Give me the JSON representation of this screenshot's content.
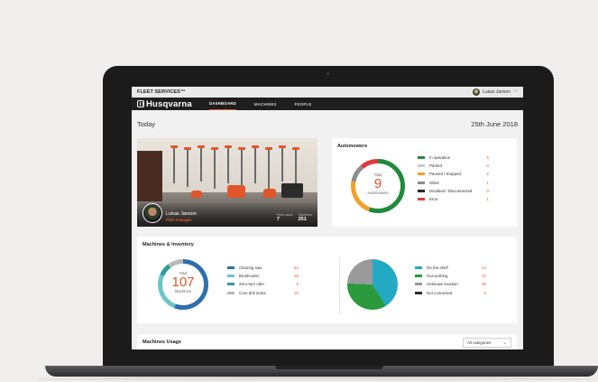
{
  "topbar": {
    "brand": "FLEET SERVICES™",
    "user_name": "Lukas Janson"
  },
  "nav": {
    "logo_text": "Husqvarna",
    "tabs": [
      {
        "label": "DASHBOARD",
        "active": true
      },
      {
        "label": "MACHINES",
        "active": false
      },
      {
        "label": "PEOPLE",
        "active": false
      }
    ]
  },
  "headline": {
    "today": "Today",
    "date": "25th June 2018"
  },
  "profile": {
    "name": "Lukas Janson",
    "role": "Fleet manager",
    "stats": [
      {
        "label": "Fleet users",
        "value": "7"
      },
      {
        "label": "Machines",
        "value": "251"
      }
    ]
  },
  "automowers": {
    "title": "Automowers",
    "center": {
      "label": "Total",
      "value": "9",
      "sub": "Automowers"
    },
    "items": [
      {
        "label": "In operation",
        "value": 5,
        "color": "#1f8a3b"
      },
      {
        "label": "Parked",
        "value": 0,
        "color": "#c9c9c9"
      },
      {
        "label": "Paused / Stopped",
        "value": 2,
        "color": "#f2a12a"
      },
      {
        "label": "Other",
        "value": 1,
        "color": "#8c8c8c"
      },
      {
        "label": "Disabled / Disconnected",
        "value": 0,
        "color": "#2b2b2b"
      },
      {
        "label": "Error",
        "value": 1,
        "color": "#e23b3b"
      }
    ]
  },
  "inventory": {
    "title": "Machines & Inventory",
    "center": {
      "label": "Total",
      "value": "107",
      "sub": "Machines"
    },
    "types": [
      {
        "label": "Clearing saw",
        "value": 54,
        "color": "#2f6fb0"
      },
      {
        "label": "Brushcutter",
        "value": 25,
        "color": "#6cc4c9"
      },
      {
        "label": "Zero-turn rider",
        "value": 8,
        "color": "#2c9c9a"
      },
      {
        "label": "Core drill motor",
        "value": 10,
        "color": "#b8b8b8"
      }
    ],
    "status": [
      {
        "label": "On the shelf",
        "value": 44,
        "color": "#22a9c4"
      },
      {
        "label": "Out working",
        "value": 37,
        "color": "#2a9a3c"
      },
      {
        "label": "Unknown location",
        "value": 26,
        "color": "#9a9a9a"
      },
      {
        "label": "Not connected",
        "value": 0,
        "color": "#2b2b2b"
      }
    ]
  },
  "usage": {
    "title": "Machines Usage",
    "filter": "All categories"
  }
}
